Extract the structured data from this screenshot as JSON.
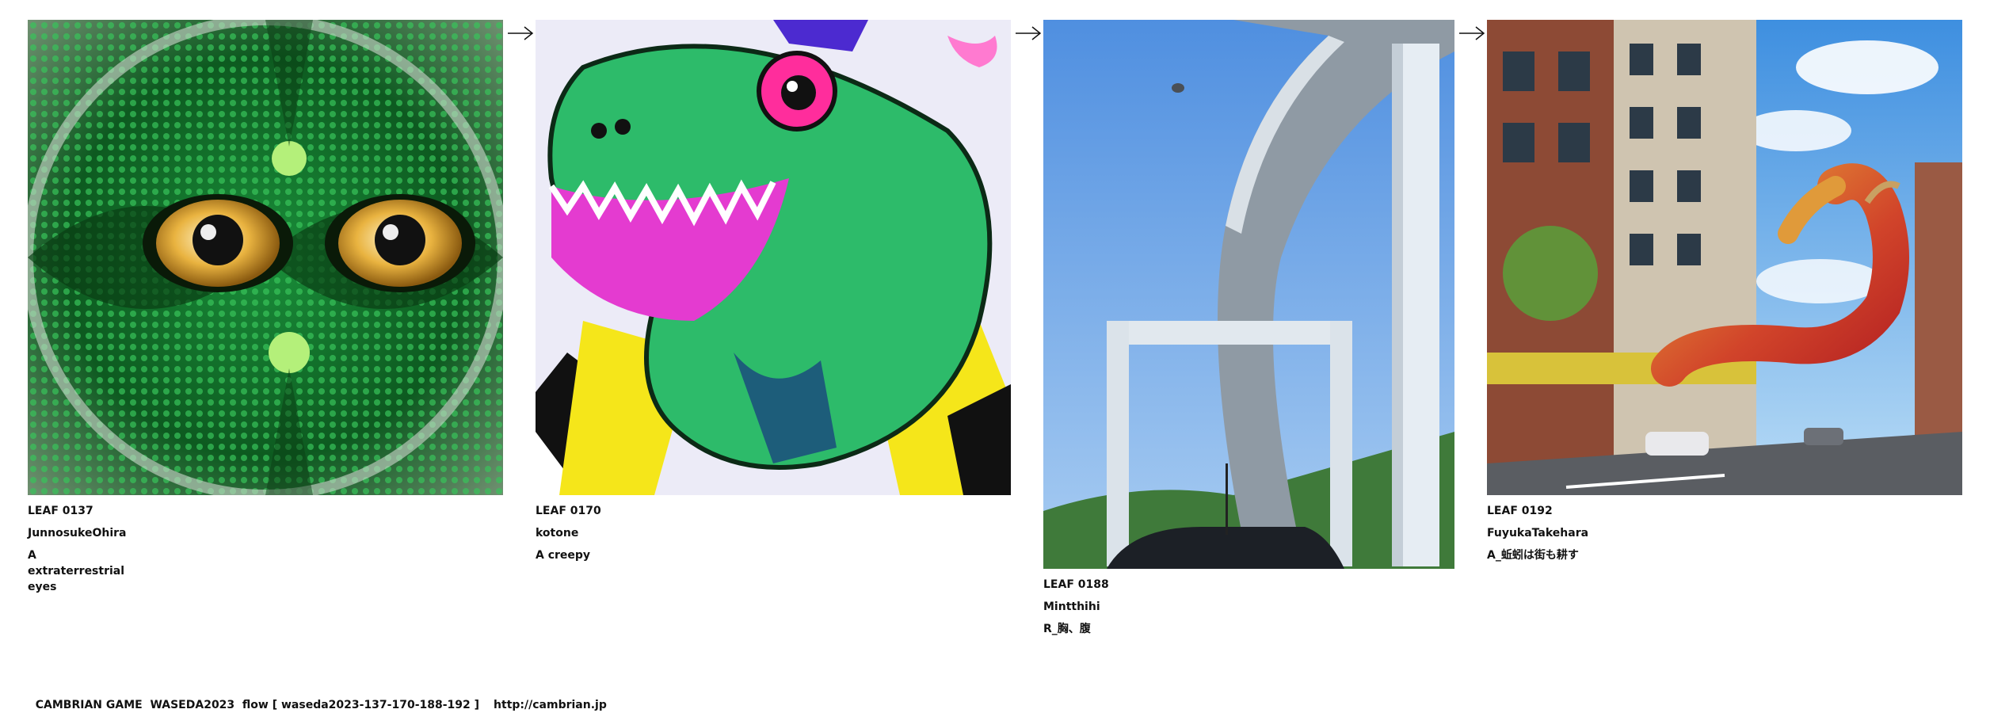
{
  "leaves": [
    {
      "image_description": "leaf-image-green-reptile-eyes",
      "code": "LEAF 0137",
      "author": "JunnosukeOhira",
      "caption": "A\nextraterrestrial eyes"
    },
    {
      "image_description": "leaf-image-green-crocodile-comic",
      "code": "LEAF 0170",
      "author": "kotone",
      "caption": "A creepy"
    },
    {
      "image_description": "leaf-image-elevated-highway-bridge",
      "code": "LEAF 0188",
      "author": "Mintthihi",
      "caption": "R_胸、腹"
    },
    {
      "image_description": "leaf-image-city-street-worm",
      "code": "LEAF 0192",
      "author": "FuyukaTakehara",
      "caption": "A_蚯蚓は街も耕す"
    }
  ],
  "footer": {
    "text": "CAMBRIAN GAME  WASEDA2023  flow [ waseda2023-137-170-188-192 ]",
    "link": "http://cambrian.jp"
  },
  "colors": {
    "text": "#111111",
    "background": "#ffffff"
  }
}
